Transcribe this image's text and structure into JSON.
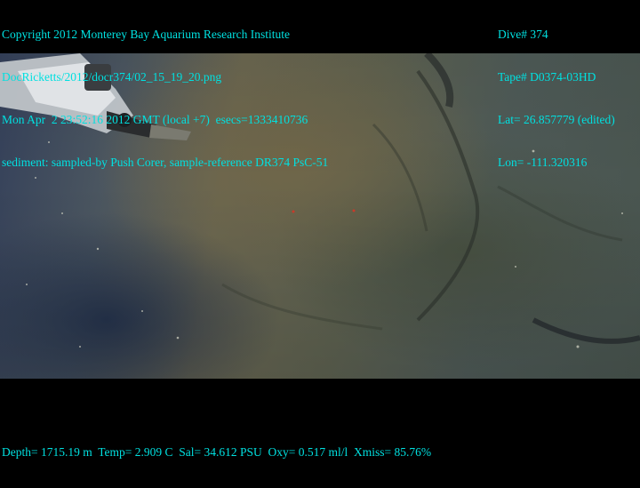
{
  "overlay": {
    "top_left": {
      "line1": "Copyright 2012 Monterey Bay Aquarium Research Institute",
      "line2": "DocRicketts/2012/docr374/02_15_19_20.png",
      "line3": "Mon Apr  2 23:52:16 2012 GMT (local +7)  esecs=1333410736",
      "line4": "sediment: sampled-by Push Corer, sample-reference DR374 PsC-51"
    },
    "top_right": {
      "line1": "Dive# 374",
      "line2": "Tape# D0374-03HD",
      "line3": "Lat= 26.857779 (edited)",
      "line4": "Lon= -111.320316"
    },
    "bottom": {
      "line1": "Depth= 1715.19 m  Temp= 2.909 C  Sal= 34.612 PSU  Oxy= 0.517 ml/l  Xmiss= 85.76%"
    },
    "text_color": "#00e0e0"
  },
  "scene": {
    "subject": "seafloor sediment with ROV manipulator arm and push corer",
    "colors": {
      "sediment": "#6a6752",
      "water_shadow": "#34405a",
      "arm": "#c8ccd0"
    }
  }
}
